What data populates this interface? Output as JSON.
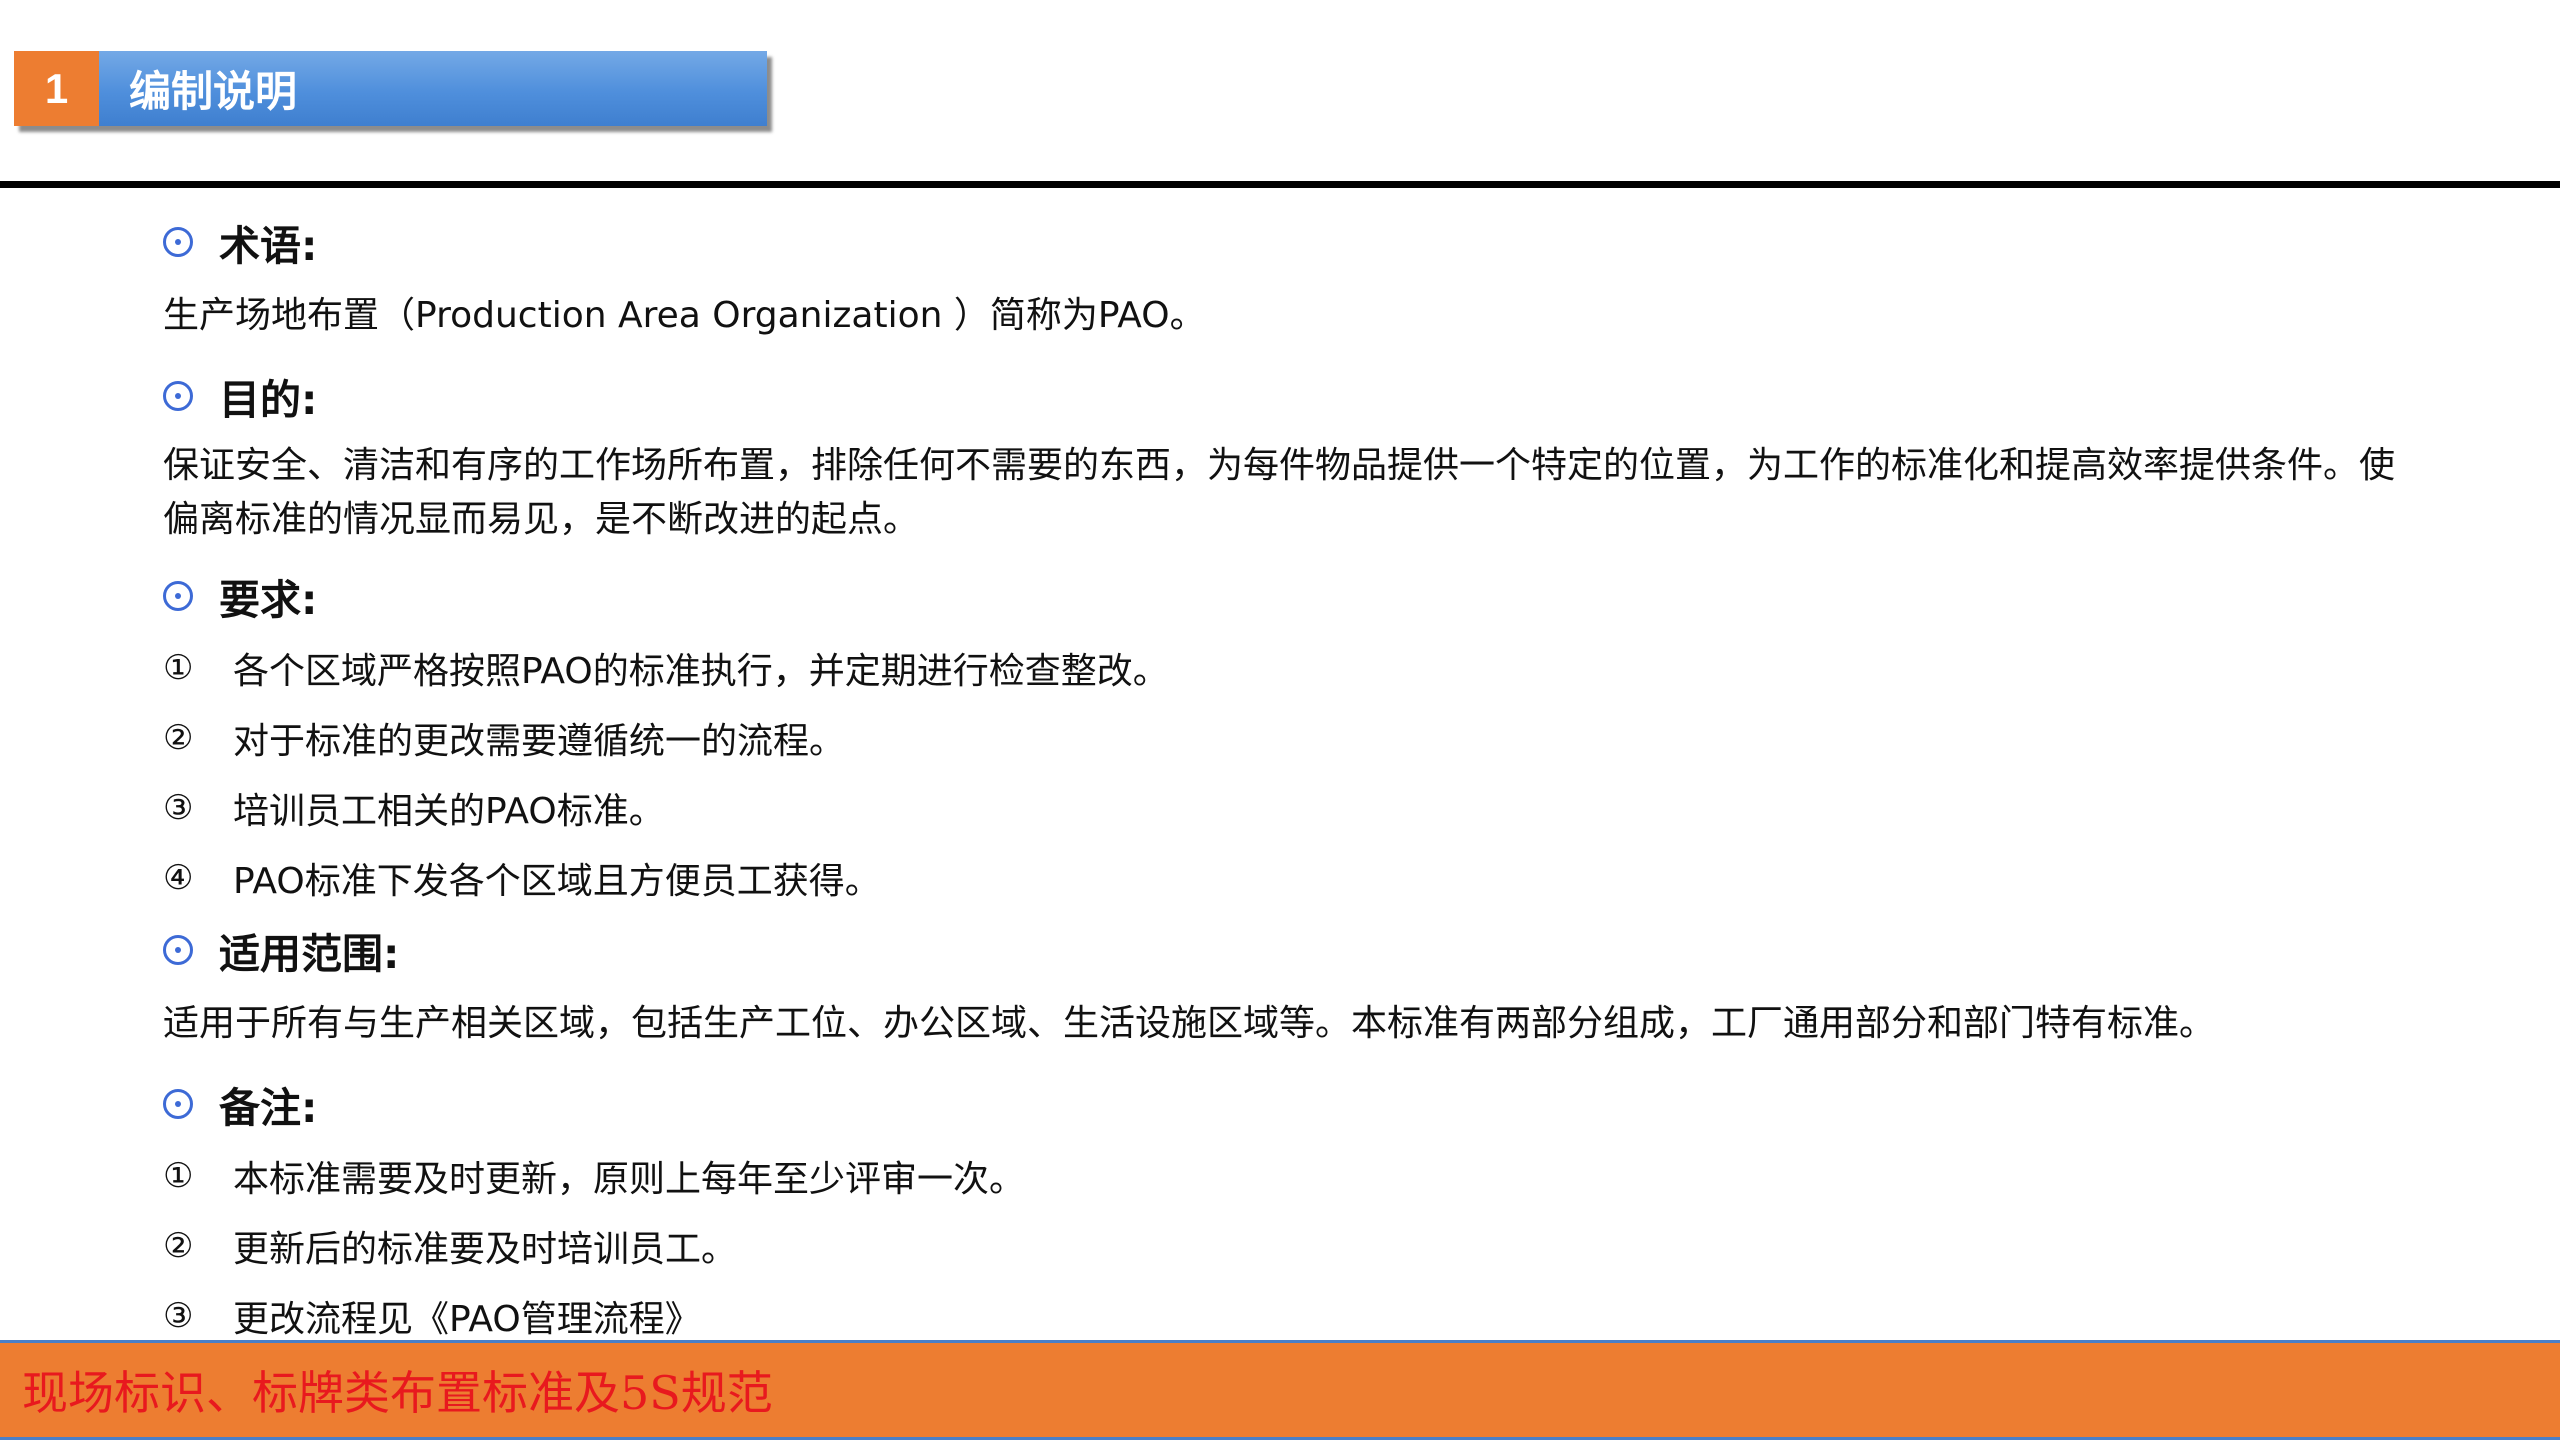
{
  "header": {
    "section_number": "1",
    "section_title": "编制说明"
  },
  "colors": {
    "accent_orange": "#ed7d31",
    "header_blue": "#4f8fdc",
    "bullet_blue": "#3d6ad6",
    "footer_text_red": "#e8191e"
  },
  "sections": {
    "terms": {
      "heading": "术语:",
      "text": "生产场地布置（Production Area Organization ）简称为PAO。"
    },
    "purpose": {
      "heading": "目的:",
      "text": "保证安全、清洁和有序的工作场所布置，排除任何不需要的东西，为每件物品提供一个特定的位置，为工作的标准化和提高效率提供条件。使偏离标准的情况显而易见，是不断改进的起点。"
    },
    "requirements": {
      "heading": "要求:",
      "items": [
        {
          "marker": "①",
          "text": "各个区域严格按照PAO的标准执行，并定期进行检查整改。"
        },
        {
          "marker": "②",
          "text": "对于标准的更改需要遵循统一的流程。"
        },
        {
          "marker": "③",
          "text": "培训员工相关的PAO标准。"
        },
        {
          "marker": "④",
          "text": "PAO标准下发各个区域且方便员工获得。"
        }
      ]
    },
    "scope": {
      "heading": "适用范围:",
      "text": "适用于所有与生产相关区域，包括生产工位、办公区域、生活设施区域等。本标准有两部分组成，工厂通用部分和部门特有标准。"
    },
    "notes": {
      "heading": "备注:",
      "items": [
        {
          "marker": "①",
          "text": "本标准需要及时更新，原则上每年至少评审一次。"
        },
        {
          "marker": "②",
          "text": "更新后的标准要及时培训员工。"
        },
        {
          "marker": "③",
          "text": "更改流程见《PAO管理流程》"
        }
      ]
    }
  },
  "footer": {
    "title": "现场标识、标牌类布置标准及5S规范"
  }
}
